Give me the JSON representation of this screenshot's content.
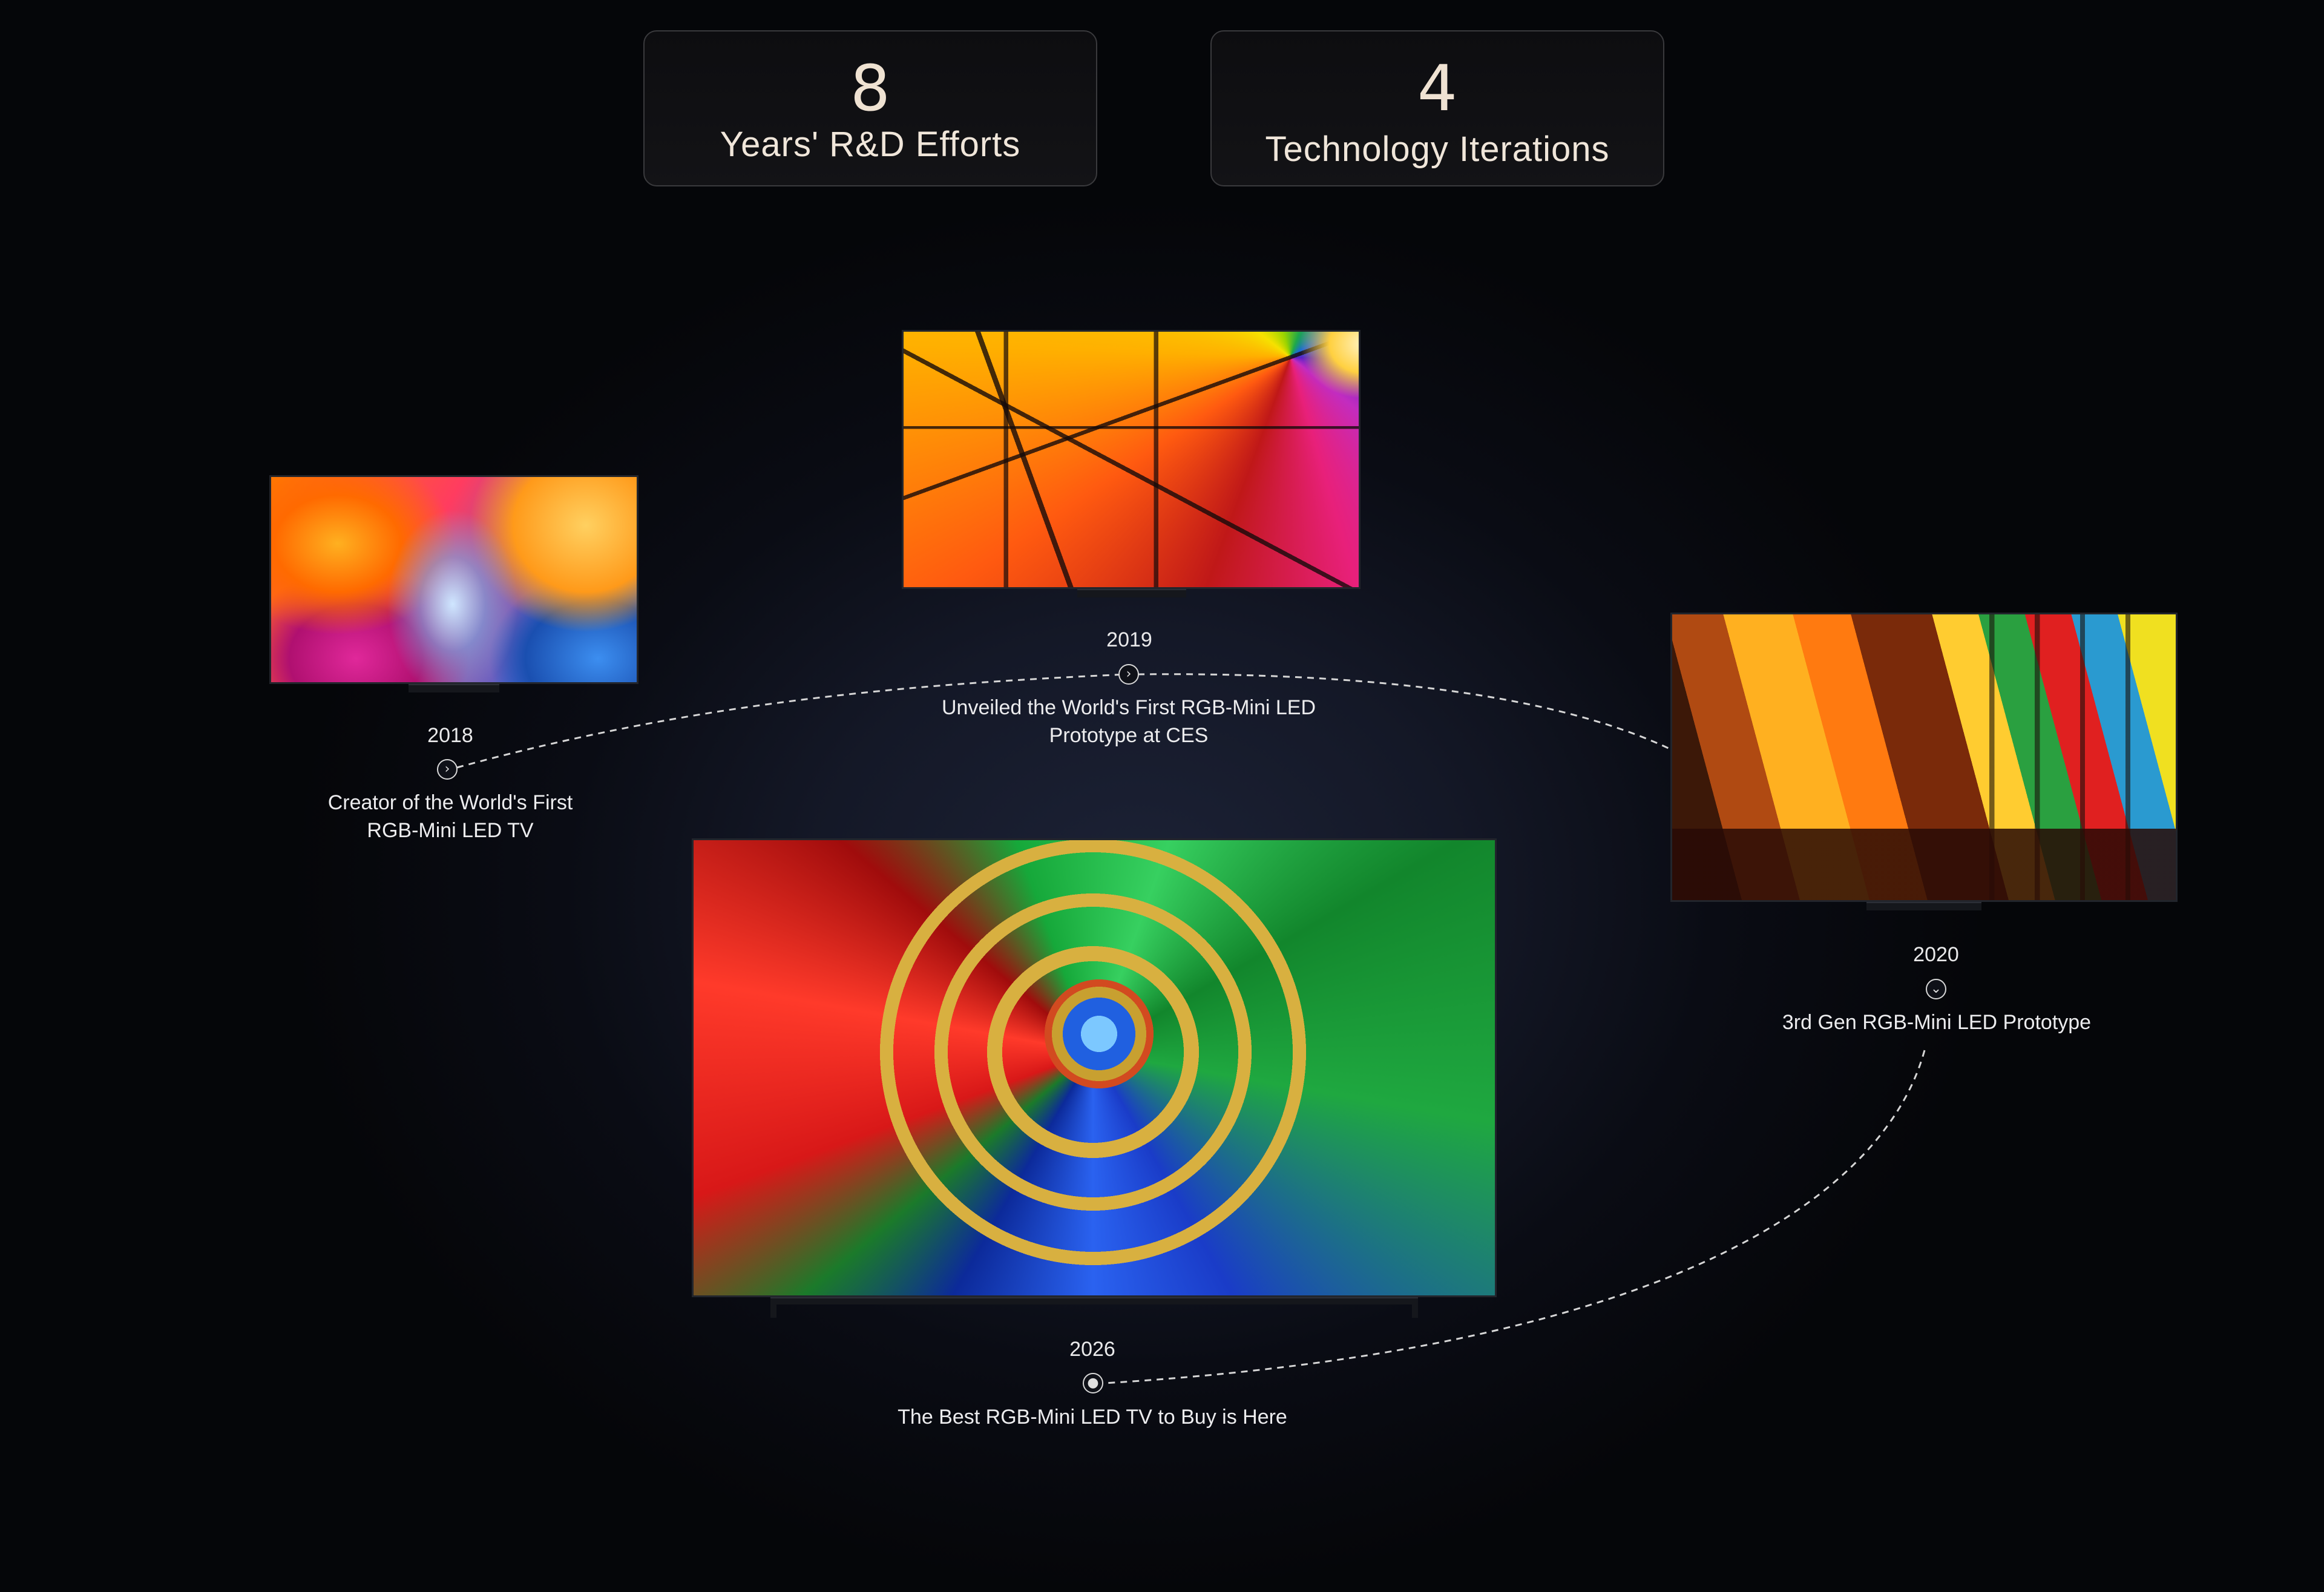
{
  "stats": [
    {
      "number": "8",
      "label": "Years' R&D Efforts"
    },
    {
      "number": "4",
      "label": "Technology Iterations"
    }
  ],
  "milestones": {
    "m2018": {
      "year": "2018",
      "description_line1": "Creator of the World's First",
      "description_line2": "RGB-Mini LED TV",
      "node_icon": "chevron-right-icon"
    },
    "m2019": {
      "year": "2019",
      "description_line1": "Unveiled the World's First RGB-Mini LED",
      "description_line2": "Prototype at CES",
      "node_icon": "chevron-right-icon"
    },
    "m2020": {
      "year": "2020",
      "description_line1": "3rd Gen RGB-Mini LED Prototype",
      "node_icon": "chevron-down-icon"
    },
    "m2026": {
      "year": "2026",
      "description_line1": "The Best RGB-Mini LED TV to Buy is Here",
      "node_icon": "dot-icon"
    }
  },
  "colors": {
    "stat_number": "#efe2d2",
    "stat_label": "#f0e6da",
    "timeline_line": "#d6d6d6"
  }
}
